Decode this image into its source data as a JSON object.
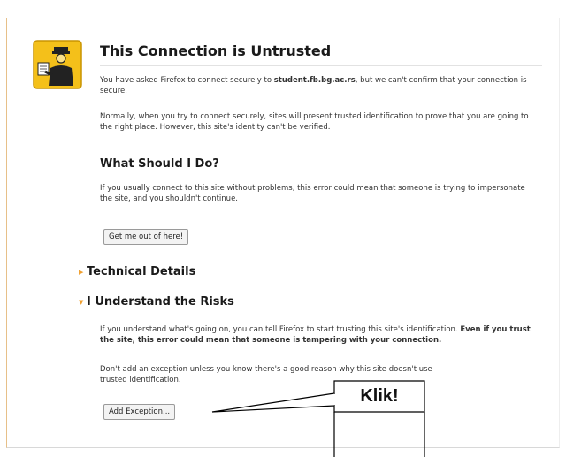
{
  "error_page": {
    "title": "This Connection is Untrusted",
    "intro_prefix": "You have asked Firefox to connect securely to ",
    "intro_host": "student.fb.bg.ac.rs",
    "intro_suffix": ", but we can't confirm that your connection is secure.",
    "normally_text": "Normally, when you try to connect securely, sites will present trusted identification to prove that you are going to the right place. However, this site's identity can't be verified.",
    "what_heading": "What Should I Do?",
    "what_text": "If you usually connect to this site without problems, this error could mean that someone is trying to impersonate the site, and you shouldn't continue.",
    "get_out_button": "Get me out of here!",
    "technical_heading": "Technical Details",
    "risks_heading": "I Understand the Risks",
    "risks_text_normal": "If you understand what's going on, you can tell Firefox to start trusting this site's identification. ",
    "risks_text_bold": "Even if you trust the site, this error could mean that someone is tampering with your connection.",
    "dont_add_text": "Don't add an exception unless you know there's a good reason why this site doesn't use trusted identification.",
    "add_exception_button": "Add Exception..."
  },
  "callout": {
    "text": "Klik!"
  },
  "icons": {
    "page_icon": "police-officer-icon",
    "collapsed": "triangle-right-icon",
    "expanded": "triangle-down-icon"
  },
  "colors": {
    "icon_background": "#f4c01a",
    "expander": "#f0a030"
  }
}
